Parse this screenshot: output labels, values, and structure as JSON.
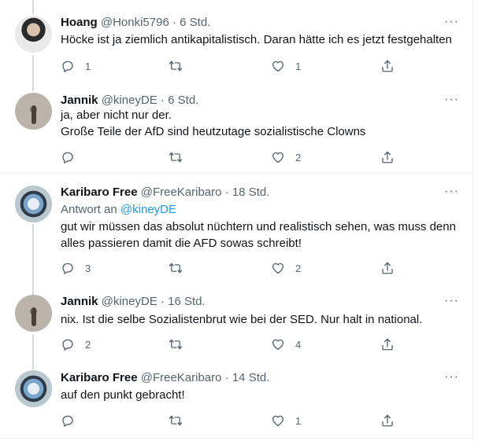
{
  "tweets": [
    {
      "name": "Hoang",
      "handle": "@Honki5796",
      "dot": "·",
      "time": "6 Std.",
      "more": "···",
      "text": "Höcke ist ja ziemlich antikapitalistisch. Daran hätte ich es jetzt festgehalten",
      "replies": "1",
      "retweets": "",
      "likes": "1"
    },
    {
      "name": "Jannik",
      "handle": "@kineyDE",
      "dot": "·",
      "time": "6 Std.",
      "more": "···",
      "text": "ja, aber nicht nur der.",
      "text2": "Große Teile der AfD sind heutzutage sozialistische Clowns",
      "replies": "",
      "retweets": "",
      "likes": "2"
    },
    {
      "name": "Karibaro Free",
      "handle": "@FreeKaribaro",
      "dot": "·",
      "time": "18 Std.",
      "more": "···",
      "replying_prefix": "Antwort an",
      "replying_handle": "@kineyDE",
      "text": "gut wir müssen das absolut nüchtern und realistisch sehen, was muss denn",
      "text2": "alles passieren damit die AFD sowas schreibt!",
      "replies": "3",
      "retweets": "",
      "likes": "2"
    },
    {
      "name": "Jannik",
      "handle": "@kineyDE",
      "dot": "·",
      "time": "16 Std.",
      "more": "···",
      "text": "nix. Ist die selbe Sozialistenbrut wie bei der SED. Nur halt in national.",
      "replies": "2",
      "retweets": "",
      "likes": "4"
    },
    {
      "name": "Karibaro Free",
      "handle": "@FreeKaribaro",
      "dot": "·",
      "time": "14 Std.",
      "more": "···",
      "text": "auf den punkt gebracht!",
      "replies": "",
      "retweets": "",
      "likes": "1"
    }
  ],
  "icons": {
    "reply": "reply-icon",
    "retweet": "retweet-icon",
    "like": "like-icon",
    "share": "share-icon"
  },
  "colors": {
    "text": "#0f1419",
    "secondary": "#536471",
    "link": "#1d9bf0",
    "thread_line": "#cfd9de",
    "divider": "#eff3f4"
  }
}
